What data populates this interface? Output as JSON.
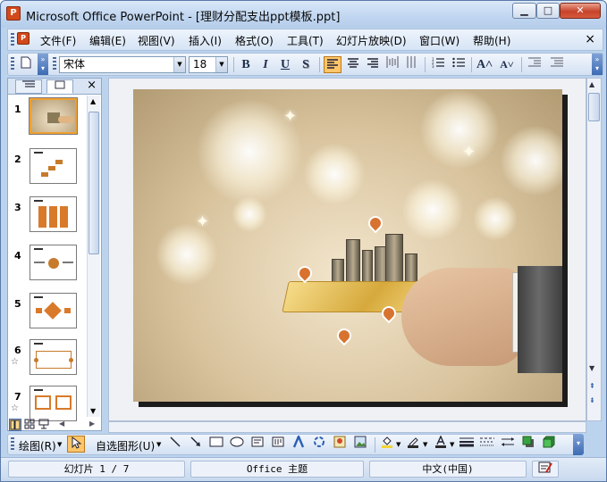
{
  "window": {
    "app_icon": "powerpoint-icon",
    "title": "Microsoft Office PowerPoint - [理财分配支出ppt模板.ppt]",
    "buttons": {
      "minimize": "▁",
      "maximize": "□",
      "close": "✕"
    }
  },
  "menu": {
    "items": [
      {
        "label": "文件(F)"
      },
      {
        "label": "编辑(E)"
      },
      {
        "label": "视图(V)"
      },
      {
        "label": "插入(I)"
      },
      {
        "label": "格式(O)"
      },
      {
        "label": "工具(T)"
      },
      {
        "label": "幻灯片放映(D)"
      },
      {
        "label": "窗口(W)"
      },
      {
        "label": "帮助(H)"
      }
    ],
    "close": "×"
  },
  "format_toolbar": {
    "font": "宋体",
    "font_size": "18",
    "bold": "B",
    "italic": "I",
    "underline": "U",
    "shadow": "S",
    "active_alignment": "align-left",
    "increase_font": "A˄",
    "decrease_font": "A˅"
  },
  "slides_pane": {
    "tabs": [
      {
        "icon": "outline-tab-icon"
      },
      {
        "icon": "slides-tab-icon",
        "selected": true
      }
    ],
    "close": "×",
    "thumbnails": [
      {
        "number": "1",
        "selected": true,
        "animated": false
      },
      {
        "number": "2",
        "selected": false,
        "animated": false
      },
      {
        "number": "3",
        "selected": false,
        "animated": false
      },
      {
        "number": "4",
        "selected": false,
        "animated": false
      },
      {
        "number": "5",
        "selected": false,
        "animated": false
      },
      {
        "number": "6",
        "selected": false,
        "animated": true
      },
      {
        "number": "7",
        "selected": false,
        "animated": true
      }
    ],
    "view_buttons": [
      "normal-view-icon",
      "slide-sorter-icon",
      "slideshow-icon"
    ]
  },
  "slide": {
    "description_icons": [
      "city-buildings",
      "gold-card",
      "hand",
      "location-pins",
      "bokeh-lights"
    ]
  },
  "drawing_toolbar": {
    "draw_label": "绘图(R)",
    "autoshapes_label": "自选图形(U)"
  },
  "status": {
    "slide_info": "幻灯片 1 / 7",
    "theme": "Office 主题",
    "language": "中文(中国)"
  },
  "colors": {
    "title_bar": "#c0d6f0",
    "active_button": "#ffc56b",
    "close_button": "#c7432b"
  }
}
